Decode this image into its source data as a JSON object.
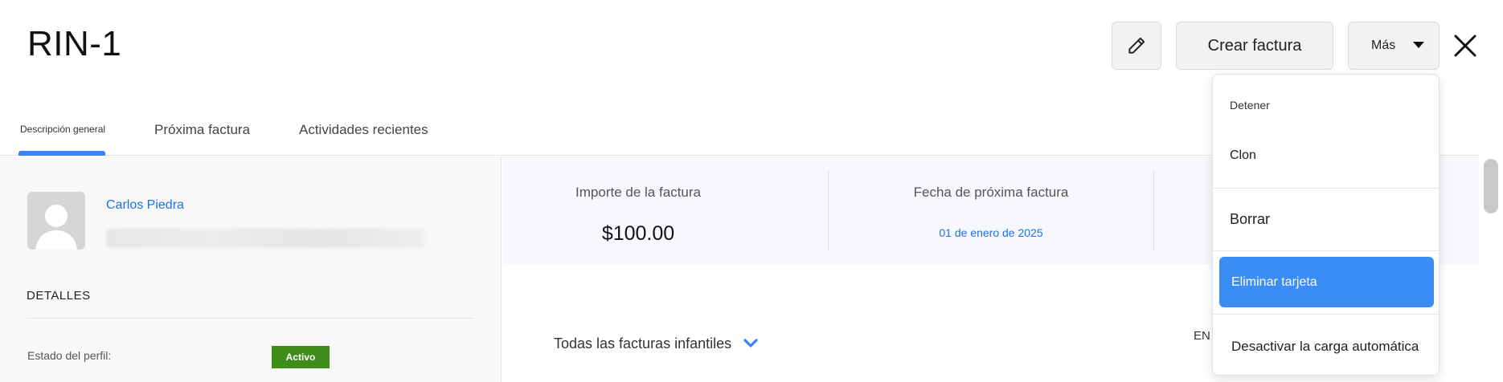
{
  "header": {
    "title": "RIN-1",
    "create_invoice_label": "Crear factura",
    "more_label": "Más"
  },
  "tabs": [
    {
      "label": "Descripción general",
      "active": true
    },
    {
      "label": "Próxima factura",
      "active": false
    },
    {
      "label": "Actividades recientes",
      "active": false
    }
  ],
  "customer": {
    "name": "Carlos Piedra"
  },
  "details": {
    "heading": "DETALLES",
    "profile_status_label": "Estado del perfil:",
    "profile_status_value": "Activo"
  },
  "summary": {
    "invoice_amount_label": "Importe de la factura",
    "invoice_amount_value": "$100.00",
    "next_invoice_date_label": "Fecha de próxima factura",
    "next_invoice_date_value": "01 de enero de 2025"
  },
  "child_invoices": {
    "filter_label": "Todas las facturas infantiles",
    "right_label": "EN"
  },
  "more_menu": {
    "items": [
      {
        "label": "Detener",
        "highlighted": false
      },
      {
        "label": "Clon",
        "highlighted": false
      },
      {
        "label": "Borrar",
        "highlighted": false
      },
      {
        "label": "Eliminar tarjeta",
        "highlighted": true
      },
      {
        "label": "Desactivar la carga automática",
        "highlighted": false
      }
    ]
  },
  "colors": {
    "accent": "#3b82f6",
    "link": "#1a73e8",
    "status_active": "#3f8c1a",
    "menu_highlight": "#3b8cf5"
  }
}
